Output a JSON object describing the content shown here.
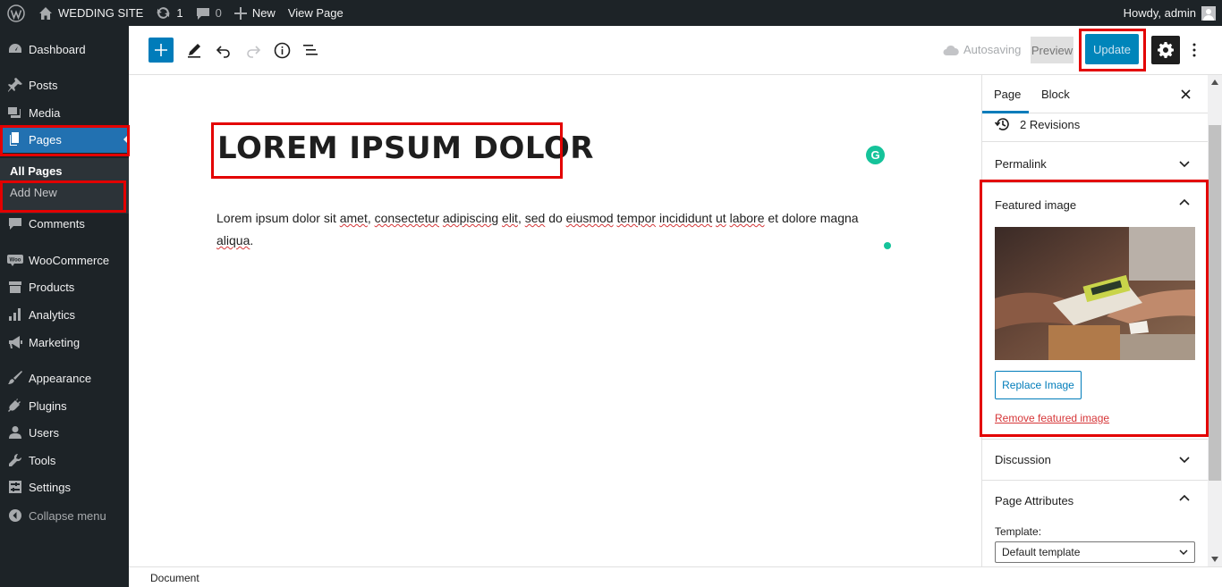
{
  "admin_bar": {
    "site_name": "WEDDING SITE",
    "updates_count": "1",
    "comments_count": "0",
    "new_label": "New",
    "view_page_label": "View Page",
    "howdy": "Howdy, admin"
  },
  "sidebar": {
    "dashboard": "Dashboard",
    "posts": "Posts",
    "media": "Media",
    "pages": "Pages",
    "all_pages": "All Pages",
    "add_new": "Add New",
    "comments": "Comments",
    "woocommerce": "WooCommerce",
    "products": "Products",
    "analytics": "Analytics",
    "marketing": "Marketing",
    "appearance": "Appearance",
    "plugins": "Plugins",
    "users": "Users",
    "tools": "Tools",
    "settings": "Settings",
    "collapse": "Collapse menu"
  },
  "toolbar": {
    "autosaving": "Autosaving",
    "preview": "Preview",
    "update": "Update"
  },
  "editor": {
    "title": "LOREM IPSUM DOLOR",
    "grammarly_letter": "G",
    "paragraph": {
      "w1": "Lorem ipsum dolor sit ",
      "w2": "amet",
      "w3": ", ",
      "w4": "consectetur",
      "w5": " ",
      "w6": "adipiscing",
      "w7": " ",
      "w8": "elit",
      "w9": ", ",
      "w10": "sed",
      "w11": " do ",
      "w12": "eiusmod",
      "w13": " ",
      "w14": "tempor",
      "w15": " ",
      "w16": "incididunt",
      "w17": " ",
      "w18": "ut",
      "w19": " ",
      "w20": "labore",
      "w21": " et dolore magna ",
      "w22": "aliqua",
      "w23": "."
    }
  },
  "panel": {
    "tab_page": "Page",
    "tab_block": "Block",
    "revisions": "2 Revisions",
    "permalink": "Permalink",
    "featured_image": "Featured image",
    "replace_image": "Replace Image",
    "remove_featured": "Remove featured image",
    "discussion": "Discussion",
    "page_attributes": "Page Attributes",
    "template_label": "Template:",
    "template_value": "Default template"
  },
  "footer": {
    "breadcrumb": "Document"
  },
  "colors": {
    "admin_dark": "#1d2327",
    "accent_blue": "#007cba",
    "highlight_red": "#e30000"
  }
}
